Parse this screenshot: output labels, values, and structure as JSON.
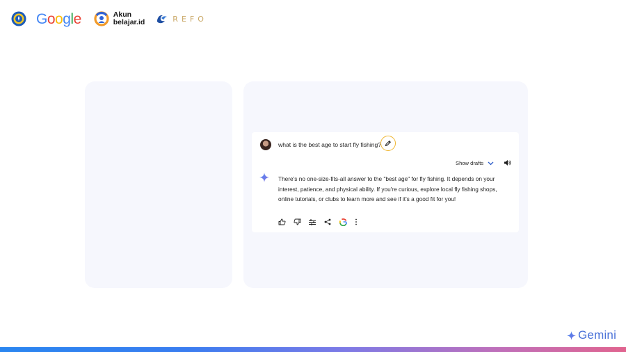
{
  "logos": {
    "google": "Google",
    "akun_line1": "Akun",
    "akun_line2": "belajar.id",
    "refo": "REFO"
  },
  "chat": {
    "prompt": "what is the best age to start fly fishing?",
    "show_drafts_label": "Show drafts",
    "response": "There's no one-size-fits-all answer to the \"best age\" for fly fishing. It depends on your interest, patience, and physical ability. If you're curious, explore local fly fishing shops, online tutorials, or clubs to learn more and see if it's a good fit for you!",
    "actions": [
      "thumbs-up-icon",
      "thumbs-down-icon",
      "modify-response-icon",
      "share-icon",
      "google-check-icon",
      "more-options-icon"
    ]
  },
  "brand": {
    "gemini_label": "Gemini"
  },
  "colors": {
    "accent_blue": "#4a72d8",
    "edit_highlight": "#f0b733",
    "panel_bg": "#f6f7fd"
  }
}
